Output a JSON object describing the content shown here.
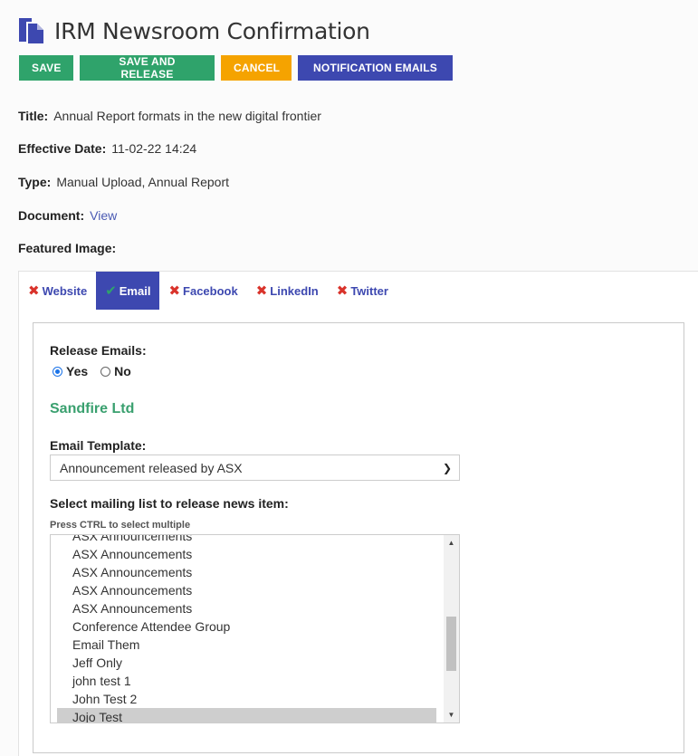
{
  "header": {
    "title": "IRM Newsroom Confirmation",
    "icon": "document-copy-icon"
  },
  "toolbar": {
    "save_label": "SAVE",
    "save_release_label": "SAVE AND RELEASE",
    "cancel_label": "CANCEL",
    "notification_label": "NOTIFICATION EMAILS"
  },
  "details": {
    "title_label": "Title:",
    "title_value": "Annual Report formats in the new digital frontier",
    "date_label": "Effective Date:",
    "date_value": "11-02-22 14:24",
    "type_label": "Type:",
    "type_value": "Manual Upload, Annual Report",
    "document_label": "Document:",
    "document_link": "View",
    "featured_label": "Featured Image:"
  },
  "tabs": [
    {
      "label": "Website",
      "status": "x"
    },
    {
      "label": "Email",
      "status": "check"
    },
    {
      "label": "Facebook",
      "status": "x"
    },
    {
      "label": "LinkedIn",
      "status": "x"
    },
    {
      "label": "Twitter",
      "status": "x"
    }
  ],
  "email": {
    "release_label": "Release Emails:",
    "yes_label": "Yes",
    "no_label": "No",
    "selected_option": "Yes",
    "company": "Sandfire Ltd",
    "template_label": "Email Template:",
    "template_value": "Announcement released by ASX",
    "mailing_label": "Select mailing list to release news item:",
    "mailing_hint": "Press CTRL to select multiple",
    "mailing_items": [
      "ASX Announcements",
      "ASX Announcements",
      "ASX Announcements",
      "ASX Announcements",
      "ASX Announcements",
      "Conference Attendee Group",
      "Email Them",
      "Jeff Only",
      "john test 1",
      "John Test 2",
      "Jojo Test"
    ],
    "selected_item": "Jojo Test"
  },
  "colors": {
    "green": "#2fa36b",
    "orange": "#f5a300",
    "indigo": "#3d48b0",
    "error_red": "#d9332b"
  }
}
